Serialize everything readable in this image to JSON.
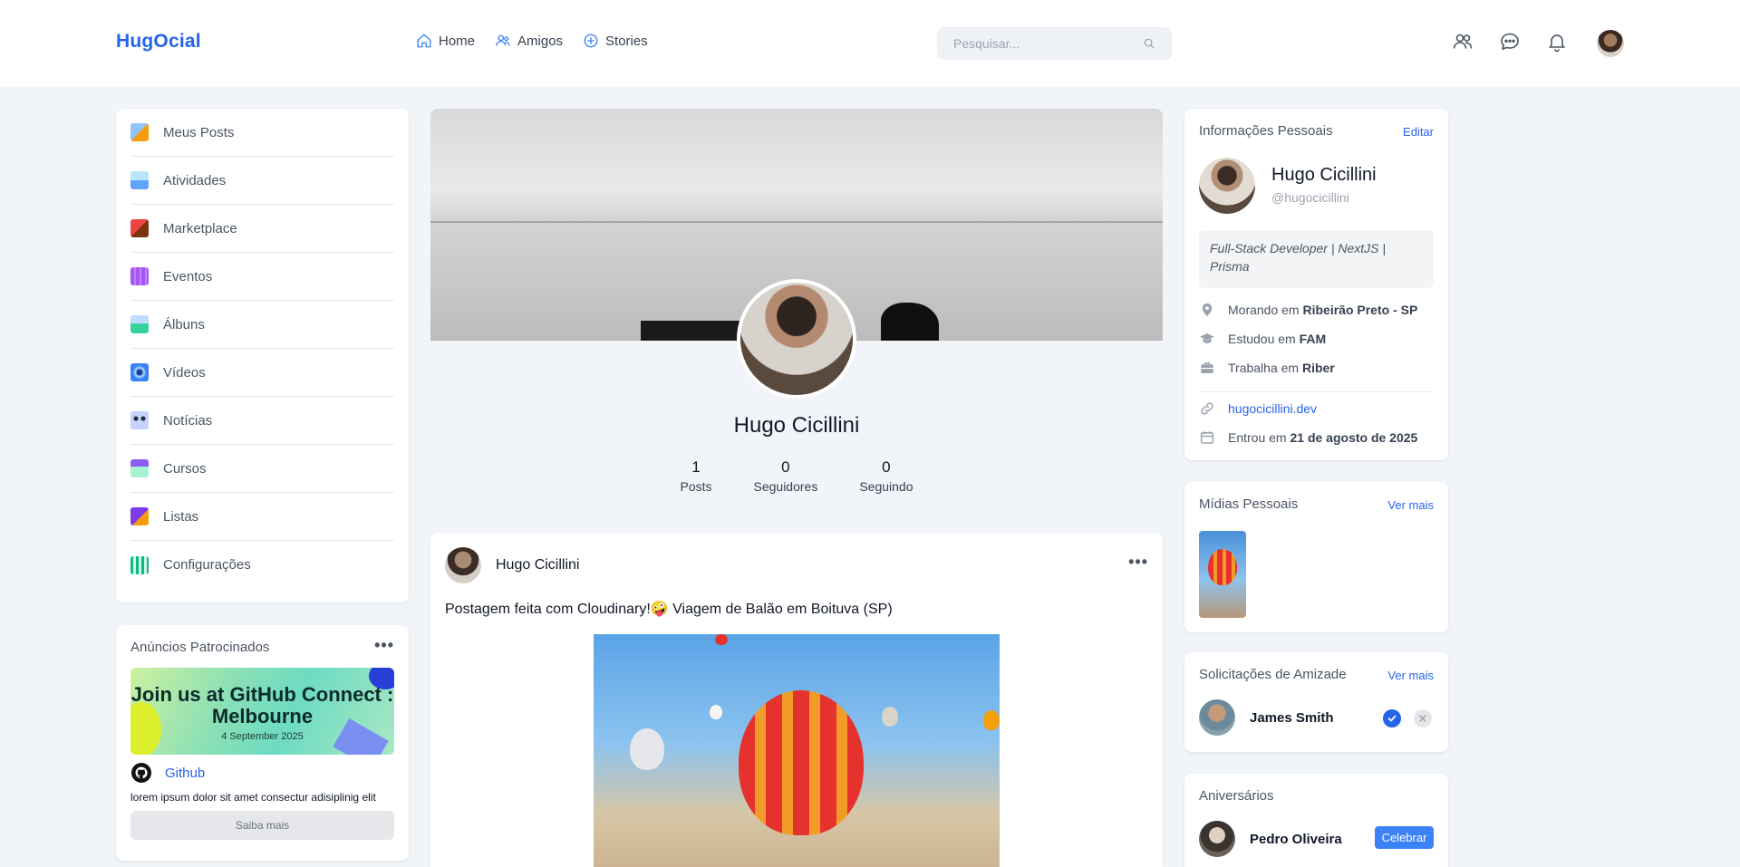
{
  "header": {
    "logo": "HugOcial",
    "nav": [
      {
        "label": "Home",
        "icon": "home-icon"
      },
      {
        "label": "Amigos",
        "icon": "friends-icon"
      },
      {
        "label": "Stories",
        "icon": "plus-circle-icon"
      }
    ],
    "search_placeholder": "Pesquisar...",
    "icons": [
      "people-icon",
      "chat-icon",
      "bell-icon"
    ],
    "accent": "#2563eb"
  },
  "menu": {
    "items": [
      {
        "label": "Meus Posts",
        "icon": "posts-icon",
        "color": "#f59e0b"
      },
      {
        "label": "Atividades",
        "icon": "activity-icon",
        "color": "#60a5fa"
      },
      {
        "label": "Marketplace",
        "icon": "marketplace-icon",
        "color": "#ef4444"
      },
      {
        "label": "Eventos",
        "icon": "calendar-icon",
        "color": "#a855f7"
      },
      {
        "label": "Álbuns",
        "icon": "album-icon",
        "color": "#34d399"
      },
      {
        "label": "Vídeos",
        "icon": "video-icon",
        "color": "#3b82f6"
      },
      {
        "label": "Notícias",
        "icon": "news-icon",
        "color": "#6366f1"
      },
      {
        "label": "Cursos",
        "icon": "courses-icon",
        "color": "#8b5cf6"
      },
      {
        "label": "Listas",
        "icon": "list-icon",
        "color": "#7c3aed"
      },
      {
        "label": "Configurações",
        "icon": "settings-icon",
        "color": "#10b981"
      }
    ]
  },
  "ads": {
    "title": "Anúncios Patrocinados",
    "banner_title": "Join us at GitHub Connect : Melbourne",
    "banner_date": "4 September 2025",
    "link": "Github",
    "text": "lorem ipsum dolor sit amet consectur adisiplinig elit",
    "button": "Saiba mais"
  },
  "profile": {
    "name": "Hugo Cicillini",
    "stats": [
      {
        "value": "1",
        "label": "Posts"
      },
      {
        "value": "0",
        "label": "Seguidores"
      },
      {
        "value": "0",
        "label": "Seguindo"
      }
    ]
  },
  "post": {
    "author": "Hugo Cicillini",
    "text": "Postagem feita com Cloudinary!🤪 Viagem de Balão em Boituva (SP)"
  },
  "info": {
    "title": "Informações Pessoais",
    "edit": "Editar",
    "name": "Hugo Cicillini",
    "handle": "@hugocicillini",
    "bio": "Full-Stack Developer | NextJS | Prisma",
    "location_prefix": "Morando em",
    "location": "Ribeirão Preto - SP",
    "study_prefix": "Estudou em",
    "study": "FAM",
    "work_prefix": "Trabalha em",
    "work": "Riber",
    "website": "hugocicillini.dev",
    "joined_prefix": "Entrou em",
    "joined": "21 de agosto de 2025"
  },
  "media": {
    "title": "Mídias Pessoais",
    "more": "Ver mais"
  },
  "friend_requests": {
    "title": "Solicitações de Amizade",
    "more": "Ver mais",
    "name": "James Smith"
  },
  "birthdays": {
    "title": "Aniversários",
    "name": "Pedro Oliveira",
    "button": "Celebrar"
  }
}
